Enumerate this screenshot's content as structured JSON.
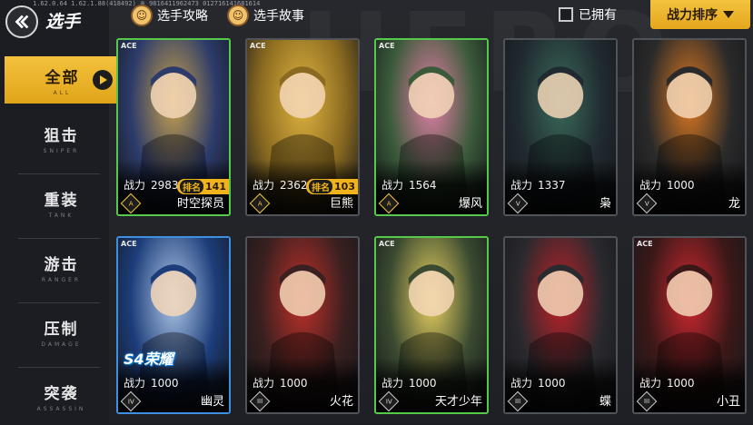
{
  "header": {
    "version_text": "1.62.0.64  1.62.1.88(418492) ※  98164119​62473  0127161416​81614",
    "title": "选手",
    "guide_label": "选手攻略",
    "story_label": "选手故事",
    "owned_label": "已拥有",
    "sort_label": "战力排序"
  },
  "sidebar": {
    "items": [
      {
        "zh": "全部",
        "en": "ALL"
      },
      {
        "zh": "狙击",
        "en": "SNIPER"
      },
      {
        "zh": "重装",
        "en": "TANK"
      },
      {
        "zh": "游击",
        "en": "RANGER"
      },
      {
        "zh": "压制",
        "en": "DAMAGE"
      },
      {
        "zh": "突袭",
        "en": "ASSASSIN"
      }
    ]
  },
  "cards": [
    {
      "ace": "ACE",
      "power_label": "战力",
      "power": "2983",
      "rank_label": "排名",
      "rank": "141",
      "name": "时空探员",
      "grade": "A",
      "border": "#55c94a",
      "art": [
        "#2c3b6a",
        "#c9a24c"
      ]
    },
    {
      "ace": "ACE",
      "power_label": "战力",
      "power": "2362",
      "rank_label": "排名",
      "rank": "103",
      "name": "巨熊",
      "grade": "A",
      "border": "#505358",
      "art": [
        "#8a6a20",
        "#e0b440"
      ]
    },
    {
      "ace": "ACE",
      "power_label": "战力",
      "power": "1564",
      "rank_label": "",
      "rank": "",
      "name": "爆风",
      "grade": "A",
      "border": "#55c94a",
      "art": [
        "#3a5a3a",
        "#e57fa8"
      ]
    },
    {
      "ace": "",
      "power_label": "战力",
      "power": "1337",
      "rank_label": "",
      "rank": "",
      "name": "枭",
      "grade": "V",
      "border": "#505358",
      "art": [
        "#202a30",
        "#3a6a5a"
      ]
    },
    {
      "ace": "",
      "power_label": "战力",
      "power": "1000",
      "rank_label": "",
      "rank": "",
      "name": "龙",
      "grade": "V",
      "border": "#505358",
      "art": [
        "#2a2a2a",
        "#e07a20"
      ]
    },
    {
      "ace": "ACE",
      "power_label": "战力",
      "power": "1000",
      "rank_label": "",
      "rank": "",
      "name": "幽灵",
      "grade": "IV",
      "border": "#3d8fe0",
      "art": [
        "#1c3d7a",
        "#b0c8e8"
      ],
      "badge": "S4荣耀"
    },
    {
      "ace": "",
      "power_label": "战力",
      "power": "1000",
      "rank_label": "",
      "rank": "",
      "name": "火花",
      "grade": "III",
      "border": "#505358",
      "art": [
        "#3a2020",
        "#c03028"
      ]
    },
    {
      "ace": "ACE",
      "power_label": "战力",
      "power": "1000",
      "rank_label": "",
      "rank": "",
      "name": "天才少年",
      "grade": "IV",
      "border": "#55c94a",
      "art": [
        "#3a4a30",
        "#e8d060"
      ]
    },
    {
      "ace": "",
      "power_label": "战力",
      "power": "1000",
      "rank_label": "",
      "rank": "",
      "name": "蝶",
      "grade": "III",
      "border": "#505358",
      "art": [
        "#2a2a2e",
        "#c02028"
      ]
    },
    {
      "ace": "ACE",
      "power_label": "战力",
      "power": "1000",
      "rank_label": "",
      "rank": "",
      "name": "小丑",
      "grade": "III",
      "border": "#505358",
      "art": [
        "#3a1818",
        "#d02830"
      ]
    }
  ]
}
